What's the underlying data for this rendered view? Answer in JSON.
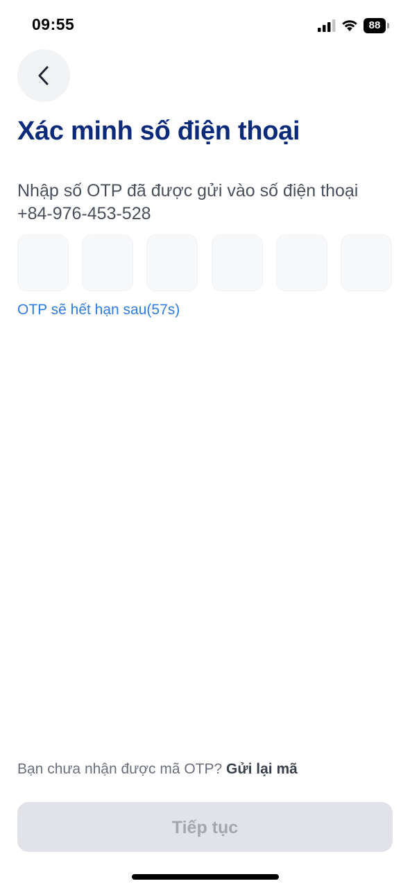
{
  "status_bar": {
    "time": "09:55",
    "battery_level": "88",
    "signal_icon": "cellular-signal-icon",
    "wifi_icon": "wifi-icon"
  },
  "header": {
    "back_icon": "chevron-left-icon",
    "title": "Xác minh số điện thoại"
  },
  "instruction": {
    "text": "Nhập số OTP đã được gửi vào số điện thoại",
    "phone": "+84-976-453-528"
  },
  "otp": {
    "digits": [
      "",
      "",
      "",
      "",
      "",
      ""
    ]
  },
  "expiry": {
    "text": "OTP sẽ hết hạn sau(57s)"
  },
  "resend": {
    "prompt": "Bạn chưa nhận được mã OTP?",
    "link": "Gửi lại mã"
  },
  "continue_button": {
    "label": "Tiếp tục"
  },
  "colors": {
    "title": "#0c2a7a",
    "accent_link": "#2f7be0",
    "button_disabled_bg": "#e2e3e8",
    "button_disabled_text": "#a3a6ae"
  }
}
